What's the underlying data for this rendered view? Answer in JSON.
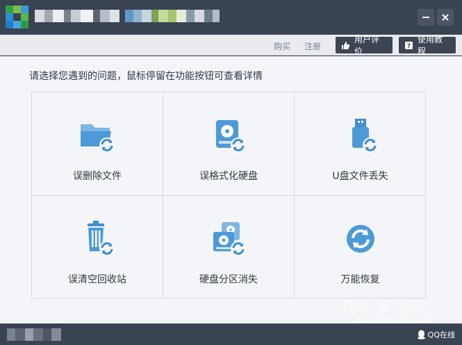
{
  "window": {
    "controls": {
      "minimize_icon": "minimize-icon",
      "close_icon": "close-icon"
    }
  },
  "toolbar": {
    "buy": "购买",
    "register": "注册",
    "user_review": "用户评价",
    "tutorial": "使用教程"
  },
  "main": {
    "prompt": "请选择您遇到的问题，鼠标停留在功能按钮可查看详情",
    "options": [
      {
        "label": "误删除文件",
        "icon": "folder-recover-icon"
      },
      {
        "label": "误格式化硬盘",
        "icon": "disk-recover-icon"
      },
      {
        "label": "U盘文件丢失",
        "icon": "usb-recover-icon"
      },
      {
        "label": "误清空回收站",
        "icon": "trash-recover-icon"
      },
      {
        "label": "硬盘分区消失",
        "icon": "partition-recover-icon"
      },
      {
        "label": "万能恢复",
        "icon": "universal-recover-icon"
      }
    ]
  },
  "footer": {
    "qq_online": "QQ在线"
  },
  "watermark": {
    "brand": "Bai",
    "brand_suffix": "经验",
    "url": "jingyan.baidu.com"
  },
  "colors": {
    "chrome": "#3a4352",
    "accent": "#3f8fd1",
    "background": "#f4f5f8"
  }
}
